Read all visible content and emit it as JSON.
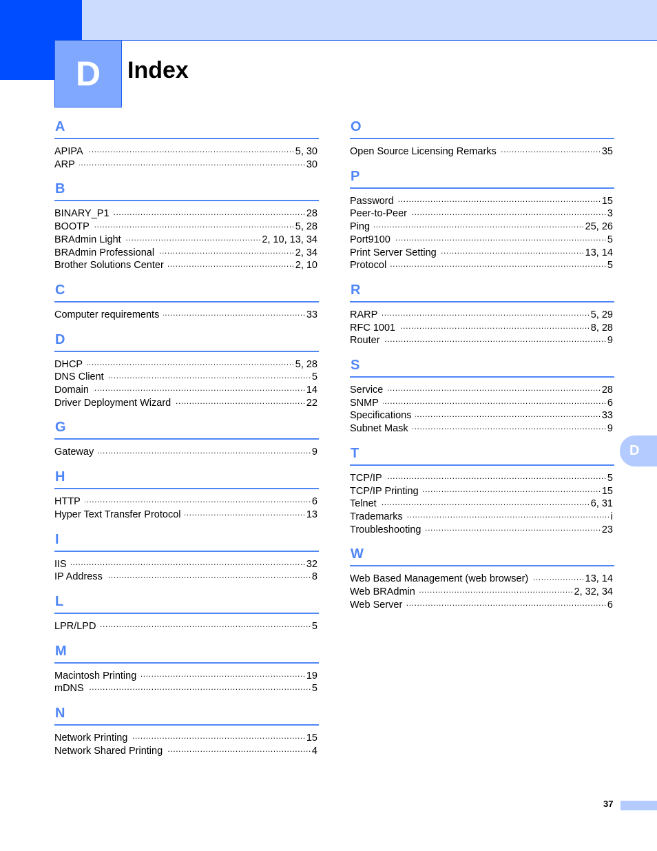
{
  "header": {
    "chapter_letter": "D",
    "title": "Index"
  },
  "side_tab": {
    "label": "D"
  },
  "footer": {
    "page_number": "37"
  },
  "colors": {
    "accent_dark": "#004cff",
    "accent_light": "#ccdcff",
    "chapter_box": "#80a8ff",
    "letter_heading": "#4f86f7",
    "tab": "#b3cbff"
  },
  "left_column": [
    {
      "letter": "A",
      "entries": [
        {
          "term": "APIPA",
          "pages": "5, 30"
        },
        {
          "term": "ARP",
          "pages": "30"
        }
      ]
    },
    {
      "letter": "B",
      "entries": [
        {
          "term": "BINARY_P1",
          "pages": "28"
        },
        {
          "term": "BOOTP",
          "pages": "5, 28"
        },
        {
          "term": "BRAdmin Light",
          "pages": "2, 10, 13, 34"
        },
        {
          "term": "BRAdmin Professional",
          "pages": "2, 34"
        },
        {
          "term": "Brother Solutions Center",
          "pages": "2, 10"
        }
      ]
    },
    {
      "letter": "C",
      "entries": [
        {
          "term": "Computer requirements",
          "pages": "33"
        }
      ]
    },
    {
      "letter": "D",
      "entries": [
        {
          "term": "DHCP",
          "pages": "5, 28"
        },
        {
          "term": "DNS Client",
          "pages": "5"
        },
        {
          "term": "Domain",
          "pages": "14"
        },
        {
          "term": "Driver Deployment Wizard",
          "pages": "22"
        }
      ]
    },
    {
      "letter": "G",
      "entries": [
        {
          "term": "Gateway",
          "pages": "9"
        }
      ]
    },
    {
      "letter": "H",
      "entries": [
        {
          "term": "HTTP",
          "pages": "6"
        },
        {
          "term": "Hyper Text Transfer Protocol",
          "pages": "13"
        }
      ]
    },
    {
      "letter": "I",
      "entries": [
        {
          "term": "IIS",
          "pages": "32"
        },
        {
          "term": "IP Address",
          "pages": "8"
        }
      ]
    },
    {
      "letter": "L",
      "entries": [
        {
          "term": "LPR/LPD",
          "pages": "5"
        }
      ]
    },
    {
      "letter": "M",
      "entries": [
        {
          "term": "Macintosh Printing",
          "pages": "19"
        },
        {
          "term": "mDNS",
          "pages": "5"
        }
      ]
    },
    {
      "letter": "N",
      "entries": [
        {
          "term": "Network Printing",
          "pages": "15"
        },
        {
          "term": "Network Shared Printing",
          "pages": "4"
        }
      ]
    }
  ],
  "right_column": [
    {
      "letter": "O",
      "entries": [
        {
          "term": "Open Source Licensing Remarks",
          "pages": "35"
        }
      ]
    },
    {
      "letter": "P",
      "entries": [
        {
          "term": "Password",
          "pages": "15"
        },
        {
          "term": "Peer-to-Peer",
          "pages": "3"
        },
        {
          "term": "Ping",
          "pages": "25, 26"
        },
        {
          "term": "Port9100",
          "pages": "5"
        },
        {
          "term": "Print Server Setting",
          "pages": "13, 14"
        },
        {
          "term": "Protocol",
          "pages": "5"
        }
      ]
    },
    {
      "letter": "R",
      "entries": [
        {
          "term": "RARP",
          "pages": "5, 29"
        },
        {
          "term": "RFC 1001",
          "pages": "8, 28"
        },
        {
          "term": "Router",
          "pages": "9"
        }
      ]
    },
    {
      "letter": "S",
      "entries": [
        {
          "term": "Service",
          "pages": "28"
        },
        {
          "term": "SNMP",
          "pages": "6"
        },
        {
          "term": "Specifications",
          "pages": "33"
        },
        {
          "term": "Subnet Mask",
          "pages": "9"
        }
      ]
    },
    {
      "letter": "T",
      "entries": [
        {
          "term": "TCP/IP",
          "pages": "5"
        },
        {
          "term": "TCP/IP Printing",
          "pages": "15"
        },
        {
          "term": "Telnet",
          "pages": "6, 31"
        },
        {
          "term": "Trademarks",
          "pages": "i"
        },
        {
          "term": "Troubleshooting",
          "pages": "23"
        }
      ]
    },
    {
      "letter": "W",
      "entries": [
        {
          "term": "Web Based Management (web browser)",
          "pages": "13, 14"
        },
        {
          "term": "Web BRAdmin",
          "pages": "2, 32, 34"
        },
        {
          "term": "Web Server",
          "pages": "6"
        }
      ]
    }
  ]
}
